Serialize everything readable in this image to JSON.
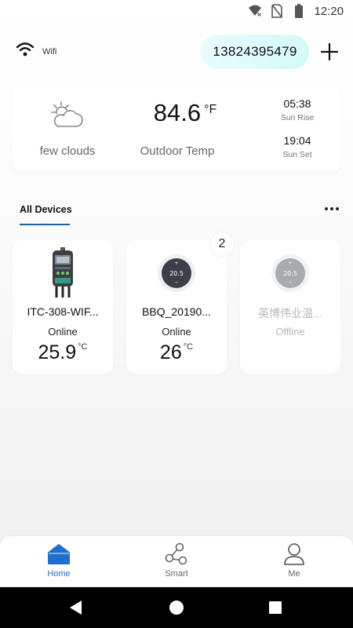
{
  "status_bar": {
    "time": "12:20"
  },
  "header": {
    "wifi_label": "Wifi",
    "phone": "13824395479"
  },
  "weather": {
    "condition": "few clouds",
    "temp_value": "84.6",
    "temp_unit": "°F",
    "temp_label": "Outdoor Temp",
    "sunrise_time": "05:38",
    "sunrise_label": "Sun Rise",
    "sunset_time": "19:04",
    "sunset_label": "Sun Set"
  },
  "devices_tab": {
    "label": "All Devices"
  },
  "devices": [
    {
      "name": "ITC-308-WIF...",
      "status": "Online",
      "temp": "25.9",
      "unit": "°C"
    },
    {
      "name": "BBQ_20190...",
      "status": "Online",
      "temp": "26",
      "unit": "°C",
      "badge": "2",
      "display": "20.5"
    },
    {
      "name": "英博伟业温...",
      "status": "Offline",
      "display": "20.5"
    }
  ],
  "bottom_nav": {
    "home": "Home",
    "smart": "Smart",
    "me": "Me"
  },
  "colors": {
    "accent": "#1f6fd1",
    "tab_underline": "#1f5fa8",
    "pill_start": "#e8fbff",
    "pill_end": "#d4fbf6"
  },
  "icons": [
    "wifi-icon",
    "add-icon",
    "cloud-sun-icon",
    "more-icon",
    "home-icon",
    "share-icon",
    "person-icon"
  ]
}
